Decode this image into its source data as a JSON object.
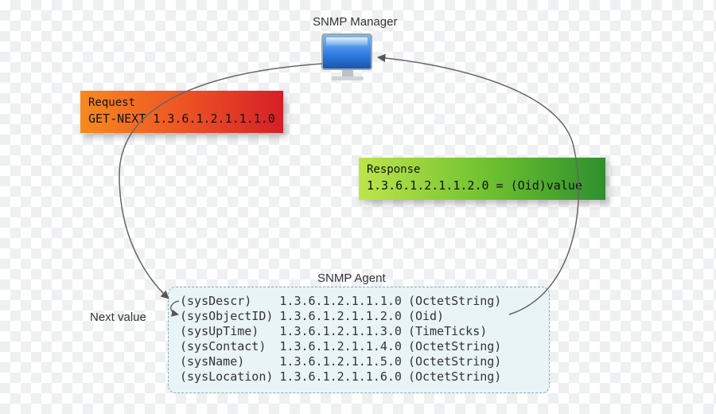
{
  "manager_label": "SNMP Manager",
  "agent_label": "SNMP Agent",
  "next_value_label": "Next value",
  "request": {
    "header": "Request",
    "command": "GET-NEXT 1.3.6.1.2.1.1.1.0"
  },
  "response": {
    "header": "Response",
    "value": "1.3.6.1.2.1.1.2.0 = (Oid)value"
  },
  "mib_rows": [
    {
      "name": "(sysDescr)",
      "oid": "1.3.6.1.2.1.1.1.0",
      "type": "(OctetString)"
    },
    {
      "name": "(sysObjectID)",
      "oid": "1.3.6.1.2.1.1.2.0",
      "type": "(Oid)"
    },
    {
      "name": "(sysUpTime)",
      "oid": "1.3.6.1.2.1.1.3.0",
      "type": "(TimeTicks)"
    },
    {
      "name": "(sysContact)",
      "oid": "1.3.6.1.2.1.1.4.0",
      "type": "(OctetString)"
    },
    {
      "name": "(sysName)",
      "oid": "1.3.6.1.2.1.1.5.0",
      "type": "(OctetString)"
    },
    {
      "name": "(sysLocation)",
      "oid": "1.3.6.1.2.1.1.6.0",
      "type": "(OctetString)"
    }
  ]
}
